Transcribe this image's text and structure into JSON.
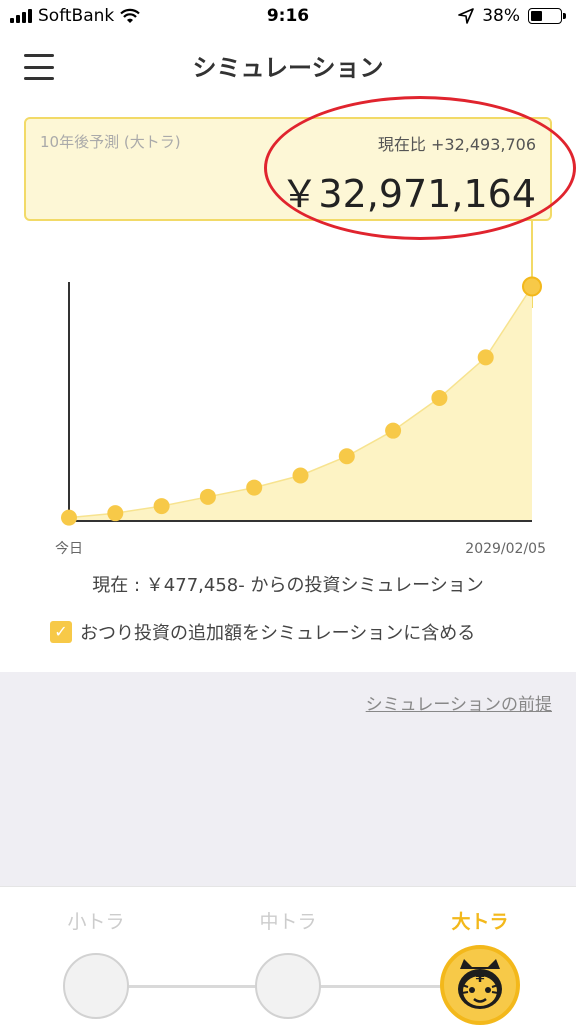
{
  "status_bar": {
    "carrier": "SoftBank",
    "time": "9:16",
    "battery": "38%",
    "battery_level": 0.38
  },
  "header": {
    "title": "シミュレーション"
  },
  "forecast": {
    "label": "10年後予測 (大トラ)",
    "diff": "現在比 +32,493,706",
    "amount": "￥32,971,164"
  },
  "chart_data": {
    "type": "line",
    "x": [
      0,
      1,
      2,
      3,
      4,
      5,
      6,
      7,
      8,
      9,
      10
    ],
    "values": [
      477458,
      1100000,
      2100000,
      3400000,
      4700000,
      6400000,
      9100000,
      12700000,
      17300000,
      23000000,
      32971164
    ],
    "xticklabels": [
      "今日",
      "2029/02/05"
    ],
    "ylim": [
      0,
      33600000
    ],
    "area_fill": true,
    "grid": false
  },
  "caption": "現在 : ￥477,458- からの投資シミュレーション",
  "option": {
    "label": "おつり投資の追加額をシミュレーションに含める",
    "checked": true,
    "check_mark": "✓"
  },
  "premise_link": "シミュレーションの前提",
  "plans": [
    {
      "label": "小トラ",
      "active": false
    },
    {
      "label": "中トラ",
      "active": false
    },
    {
      "label": "大トラ",
      "active": true
    }
  ],
  "colors": {
    "accent": "#f7c948",
    "accent_dark": "#f3b81b",
    "fill": "#fdf3c4",
    "highlight": "#e0242e"
  }
}
